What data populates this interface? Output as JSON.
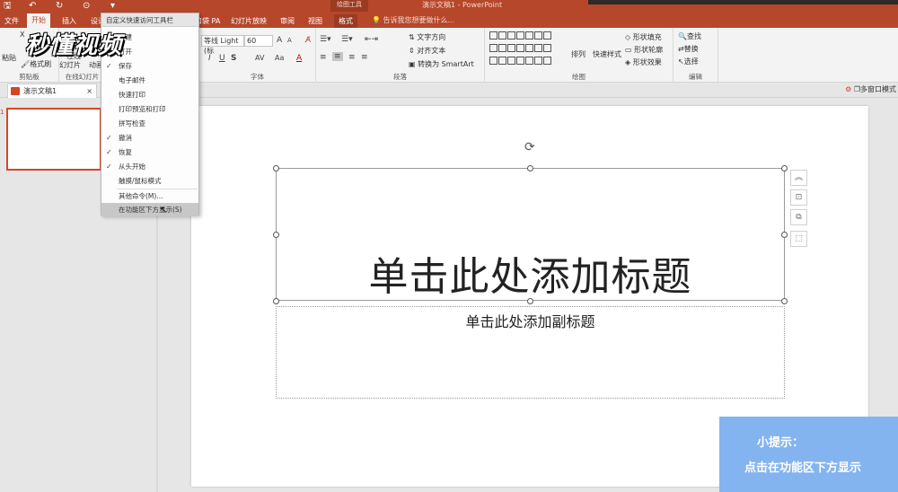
{
  "titlebar": {
    "tools_label": "绘图工具",
    "doc_title": "演示文稿1 - PowerPoint",
    "qat_icons": [
      "save-icon",
      "undo-icon",
      "redo-icon",
      "start-icon",
      "qat-dropdown-icon"
    ]
  },
  "tabs": {
    "file": "文件",
    "home": "开始",
    "insert": "插入",
    "design": "设计",
    "pa": "口袋 PA",
    "slideshow": "幻灯片放映",
    "review": "审阅",
    "view": "视图",
    "format": "格式",
    "tellme": "告诉我您想要做什么..."
  },
  "ribbon": {
    "clipboard": {
      "label": "剪贴板",
      "paste": "粘贴",
      "cut": "X",
      "format_painter": "格式刷"
    },
    "slides": {
      "label": "在线幻灯片",
      "online_line1": "在线",
      "online_line2": "幻灯片",
      "animation": "动画"
    },
    "font": {
      "label": "字体",
      "font_name": "等线 Light (标",
      "font_size": "60",
      "grow": "A",
      "shrink": "A",
      "italic": "I",
      "underline": "U",
      "strike": "S",
      "spacing": "AV",
      "case": "Aa",
      "color": "A"
    },
    "paragraph": {
      "label": "段落",
      "text_direction": "文字方向",
      "align_text": "对齐文本",
      "smartart": "转换为 SmartArt"
    },
    "drawing": {
      "label": "绘图",
      "arrange": "排列",
      "quick_styles": "快速样式",
      "fill": "形状填充",
      "outline": "形状轮廓",
      "effects": "形状效果"
    },
    "editing": {
      "label": "编辑",
      "find": "查找",
      "replace": "替换",
      "select": "选择"
    }
  },
  "doctab": {
    "name": "演示文稿1",
    "multiwindow": "多窗口模式"
  },
  "thumbnail": {
    "number": "1"
  },
  "menu": {
    "header": "自定义快速访问工具栏",
    "items": [
      {
        "label": "新建",
        "checked": false
      },
      {
        "label": "打开",
        "checked": false
      },
      {
        "label": "保存",
        "checked": true
      },
      {
        "label": "电子邮件",
        "checked": false
      },
      {
        "label": "快速打印",
        "checked": false
      },
      {
        "label": "打印预览和打印",
        "checked": false
      },
      {
        "label": "拼写检查",
        "checked": false
      },
      {
        "label": "撤消",
        "checked": true
      },
      {
        "label": "恢复",
        "checked": true
      },
      {
        "label": "从头开始",
        "checked": true
      },
      {
        "label": "触摸/鼠标模式",
        "checked": false
      },
      {
        "label": "其他命令(M)...",
        "checked": false
      },
      {
        "label": "在功能区下方显示(S)",
        "checked": false
      }
    ]
  },
  "slide": {
    "title_placeholder": "单击此处添加标题",
    "subtitle_placeholder": "单击此处添加副标题"
  },
  "logo": {
    "text": "秒懂视频"
  },
  "tip": {
    "title": "小提示：",
    "body": "点击在功能区下方显示"
  },
  "colors": {
    "accent": "#b7472a",
    "tip_bg": "#84b4f0"
  }
}
